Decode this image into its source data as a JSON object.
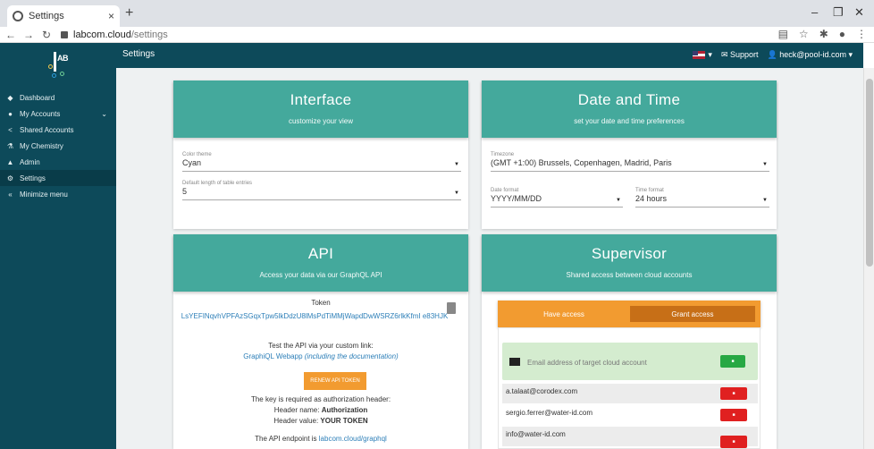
{
  "browser": {
    "tab_title": "Settings",
    "tab_close": "×",
    "new_tab": "+",
    "url_host": "labcom.cloud",
    "url_path": "/settings",
    "minimize": "–",
    "restore": "❐",
    "close": "✕"
  },
  "logo": {
    "text": "AB"
  },
  "sidebar": {
    "items": [
      {
        "label": "Dashboard",
        "icon": "dashboard-icon"
      },
      {
        "label": "My Accounts",
        "icon": "users-icon"
      },
      {
        "label": "Shared Accounts",
        "icon": "share-icon"
      },
      {
        "label": "My Chemistry",
        "icon": "flask-icon"
      },
      {
        "label": "Admin",
        "icon": "admin-icon"
      },
      {
        "label": "Settings",
        "icon": "gears-icon"
      },
      {
        "label": "Minimize menu",
        "icon": "double-chevron-left-icon"
      }
    ]
  },
  "topbar": {
    "title": "Settings",
    "support": "Support",
    "user": "heck@pool-id.com"
  },
  "interface_card": {
    "title": "Interface",
    "subtitle": "customize your view",
    "color_theme_label": "Color theme",
    "color_theme_value": "Cyan",
    "table_length_label": "Default length of table entries",
    "table_length_value": "5"
  },
  "datetime_card": {
    "title": "Date and Time",
    "subtitle": "set your date and time preferences",
    "timezone_label": "Timezone",
    "timezone_value": "(GMT +1:00) Brussels, Copenhagen, Madrid, Paris",
    "date_format_label": "Date format",
    "date_format_value": "YYYY/MM/DD",
    "time_format_label": "Time format",
    "time_format_value": "24 hours"
  },
  "api_card": {
    "title": "API",
    "subtitle": "Access your data via our GraphQL API",
    "token_label": "Token",
    "token_value": "LsYEFINqvhVPFAzSGqxTpw5lkDdzU8lMsPdTiMMjWapdDwWSRZ6rlkKfmI e83HJK",
    "test_text": "Test the API via your custom link:",
    "webapp_link": "GraphiQL Webapp",
    "webapp_note": "(including the documentation)",
    "renew_button": "RENEW API TOKEN",
    "key_required": "The key is required as authorization header:",
    "header_name_prefix": "Header name:",
    "header_name_value": "Authorization",
    "header_value_prefix": "Header value:",
    "header_value_value": "YOUR TOKEN",
    "endpoint_prefix": "The API endpoint is",
    "endpoint_link": "labcom.cloud/graphql"
  },
  "supervisor_card": {
    "title": "Supervisor",
    "subtitle": "Shared access between cloud accounts",
    "tab_have_access": "Have access",
    "tab_grant_access": "Grant access",
    "email_placeholder": "Email address of target cloud account",
    "emails": [
      "a.talaat@corodex.com",
      "sergio.ferrer@water-id.com",
      "info@water-id.com"
    ]
  },
  "colors": {
    "sidebar_bg": "#0d4a5a",
    "card_header": "#44a99c",
    "accent_orange": "#f29b30",
    "add_green": "#27a844",
    "delete_red": "#e02020"
  }
}
